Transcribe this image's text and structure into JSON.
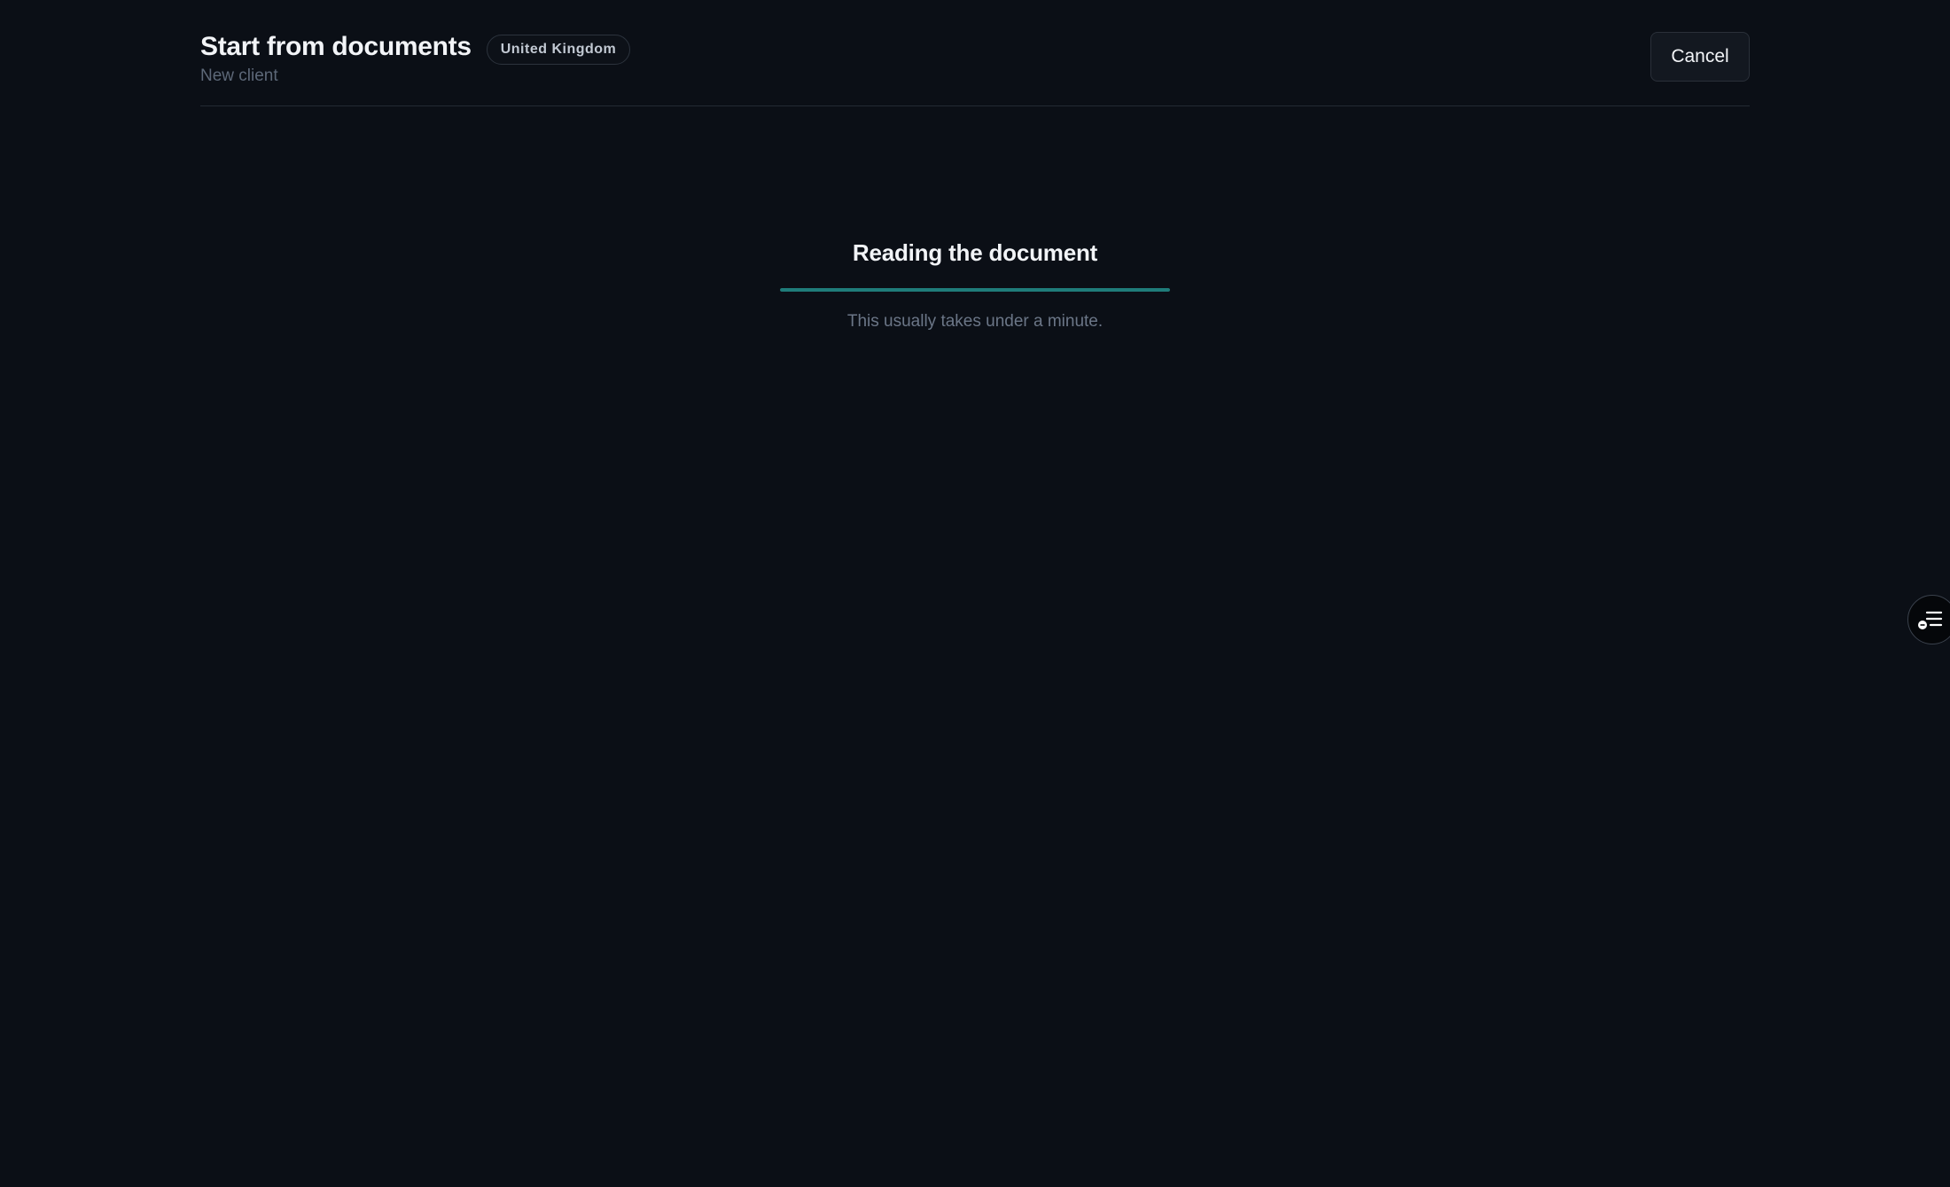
{
  "header": {
    "title": "Start from documents",
    "badge": "United Kingdom",
    "subtitle": "New client",
    "cancel_label": "Cancel"
  },
  "status": {
    "title": "Reading the document",
    "progress": 1.0,
    "note": "This usually takes under a minute."
  },
  "side_tool": {
    "icon": "checklist-icon"
  },
  "colors": {
    "background": "#0b0f16",
    "progress_accent": "#1f7c7a",
    "text_primary": "#f2f4f7",
    "text_muted": "#6b7687"
  }
}
